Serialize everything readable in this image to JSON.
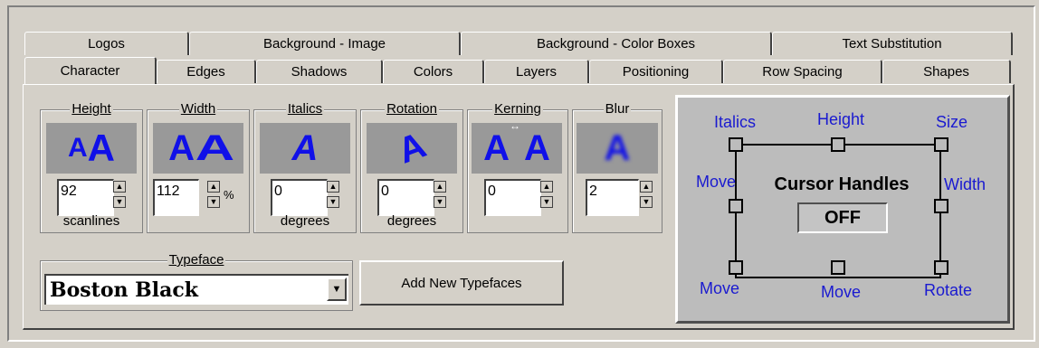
{
  "tabs_row1": [
    "Logos",
    "Background - Image",
    "Background - Color Boxes",
    "Text Substitution"
  ],
  "tabs_row2": [
    "Character",
    "Edges",
    "Shadows",
    "Colors",
    "Layers",
    "Positioning",
    "Row Spacing",
    "Shapes"
  ],
  "active_tab": "Character",
  "controls": {
    "height": {
      "label": "Height",
      "value": "92",
      "unit": "scanlines"
    },
    "width": {
      "label": "Width",
      "value": "112",
      "unit": "%"
    },
    "italics": {
      "label": "Italics",
      "value": "0",
      "unit": "degrees"
    },
    "rotation": {
      "label": "Rotation",
      "value": "0",
      "unit": "degrees"
    },
    "kerning": {
      "label": "Kerning",
      "value": "0"
    },
    "blur": {
      "label": "Blur",
      "value": "2"
    }
  },
  "typeface": {
    "label": "Typeface",
    "value": "Boston Black"
  },
  "add_typefaces_button": "Add New Typefaces",
  "cursor_handles": {
    "title": "Cursor Handles",
    "state": "OFF",
    "labels": {
      "italics": "Italics",
      "height": "Height",
      "size": "Size",
      "move_left": "Move",
      "width": "Width",
      "move_bottom_left": "Move",
      "move_bottom": "Move",
      "rotate": "Rotate"
    }
  }
}
